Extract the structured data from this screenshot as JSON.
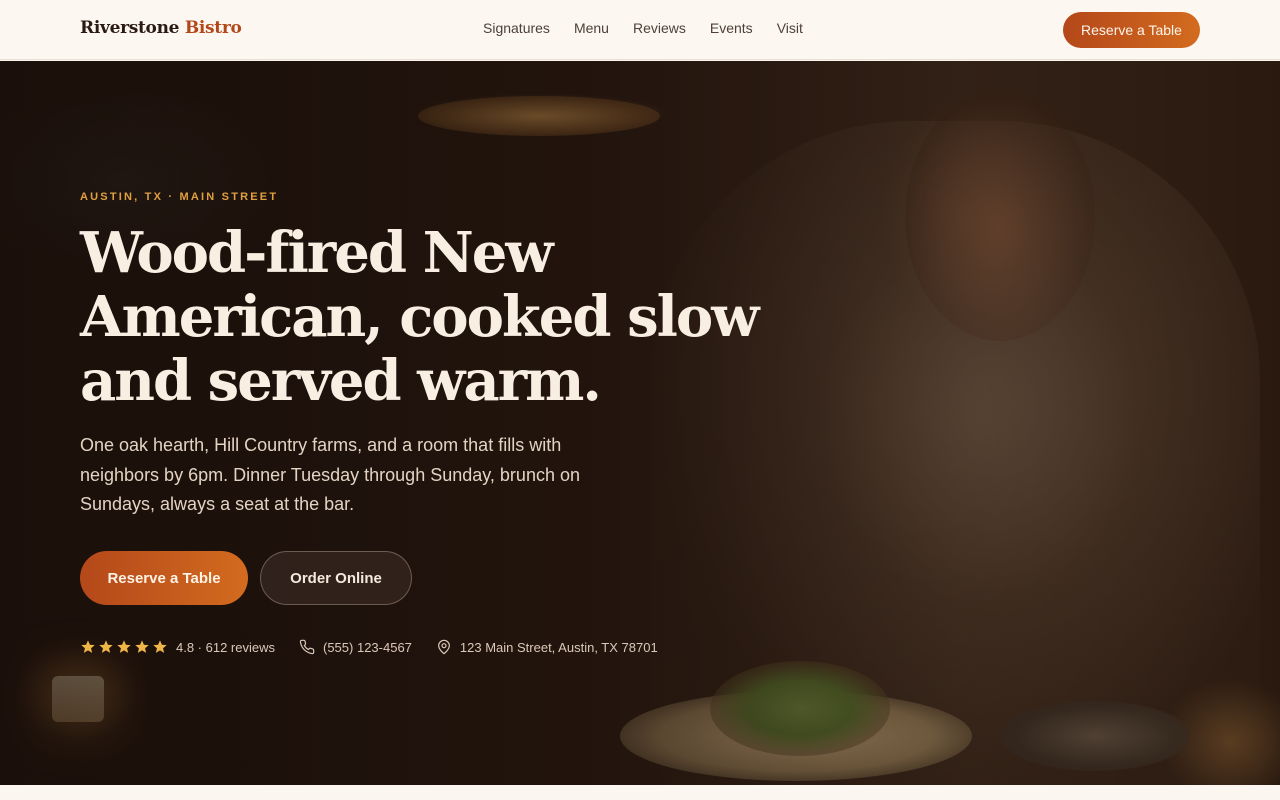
{
  "header": {
    "logo_primary": "Riverstone",
    "logo_accent": "Bistro",
    "nav": [
      "Signatures",
      "Menu",
      "Reviews",
      "Events",
      "Visit"
    ],
    "cta": "Reserve a Table"
  },
  "hero": {
    "eyebrow": "AUSTIN, TX · MAIN STREET",
    "headline": "Wood-fired New American, cooked slow and served warm.",
    "subtext": "One oak hearth, Hill Country farms, and a room that fills with neighbors by 6pm. Dinner Tuesday through Sunday, brunch on Sundays, always a seat at the bar.",
    "primary_cta": "Reserve a Table",
    "secondary_cta": "Order Online",
    "rating": {
      "stars": 5,
      "text": "4.8 · 612 reviews"
    },
    "phone": "(555) 123-4567",
    "address": "123 Main Street, Austin, TX 78701"
  },
  "colors": {
    "accent": "#b4471a",
    "accent_gradient_end": "#d36b1f",
    "eyebrow": "#e1a03f",
    "star": "#f0b548",
    "page_bg": "#fbf6f0"
  },
  "icons": {
    "rating": "star-icon",
    "phone": "phone-icon",
    "address": "map-pin-icon"
  }
}
